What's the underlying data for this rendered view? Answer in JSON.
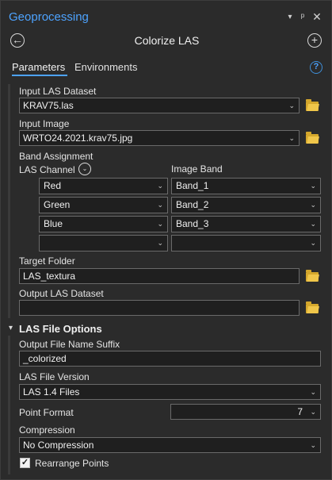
{
  "window": {
    "title": "Geoprocessing",
    "menu_icon": "chevron-down-icon",
    "pin_icon": "pin-icon",
    "close_icon": "close-icon"
  },
  "header": {
    "tool_title": "Colorize LAS",
    "back_icon": "back-arrow-icon",
    "add_icon": "add-icon"
  },
  "tabs": [
    {
      "label": "Parameters",
      "active": true
    },
    {
      "label": "Environments",
      "active": false
    }
  ],
  "help_label": "?",
  "params": {
    "input_las_label": "Input LAS Dataset",
    "input_las_value": "KRAV75.las",
    "input_image_label": "Input Image",
    "input_image_value": "WRTO24.2021.krav75.jpg",
    "band_assignment_label": "Band Assignment",
    "las_channel_label": "LAS Channel",
    "image_band_label": "Image Band",
    "band_rows": [
      {
        "channel": "Red",
        "band": "Band_1"
      },
      {
        "channel": "Green",
        "band": "Band_2"
      },
      {
        "channel": "Blue",
        "band": "Band_3"
      },
      {
        "channel": "",
        "band": ""
      }
    ],
    "target_folder_label": "Target Folder",
    "target_folder_value": "LAS_textura",
    "output_las_label": "Output LAS Dataset",
    "output_las_value": ""
  },
  "las_options": {
    "section_label": "LAS File Options",
    "suffix_label": "Output File Name Suffix",
    "suffix_value": "_colorized",
    "version_label": "LAS File Version",
    "version_value": "LAS 1.4 Files",
    "point_format_label": "Point Format",
    "point_format_value": "7",
    "compression_label": "Compression",
    "compression_value": "No Compression",
    "rearrange_label": "Rearrange Points",
    "rearrange_checked": true
  },
  "colors": {
    "accent": "#4da3ff",
    "folder": "#d4a72c",
    "background": "#2b2b2b",
    "field": "#1f1f1f"
  }
}
